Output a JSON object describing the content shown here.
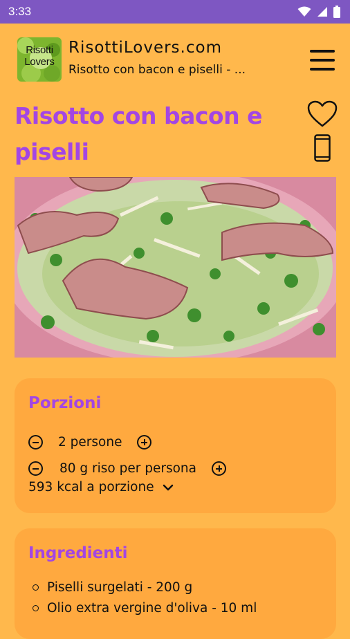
{
  "status_bar": {
    "time": "3:33",
    "icons": [
      "wifi-icon",
      "signal-icon",
      "battery-icon"
    ]
  },
  "header": {
    "logo_text_line1": "Risotti",
    "logo_text_line2": "Lovers",
    "site_name": "RisottiLovers.com",
    "subtitle": "Risotto con bacon e piselli - ...",
    "menu_icon": "hamburger-menu-icon"
  },
  "recipe": {
    "title": "Risotto con bacon e piselli",
    "favorite_icon": "heart-icon",
    "phone_icon": "phone-icon"
  },
  "portions": {
    "title": "Porzioni",
    "persons_label": "2 persone",
    "rice_label": "80 g riso per persona",
    "kcal_label": "593 kcal a porzione"
  },
  "ingredients": {
    "title": "Ingredienti",
    "items": [
      "Piselli surgelati - 200 g",
      "Olio extra vergine d'oliva - 10 ml"
    ]
  },
  "colors": {
    "status_bar": "#7E57C2",
    "background": "#FFB84C",
    "card": "#FFA93F",
    "accent": "#A346E3"
  }
}
